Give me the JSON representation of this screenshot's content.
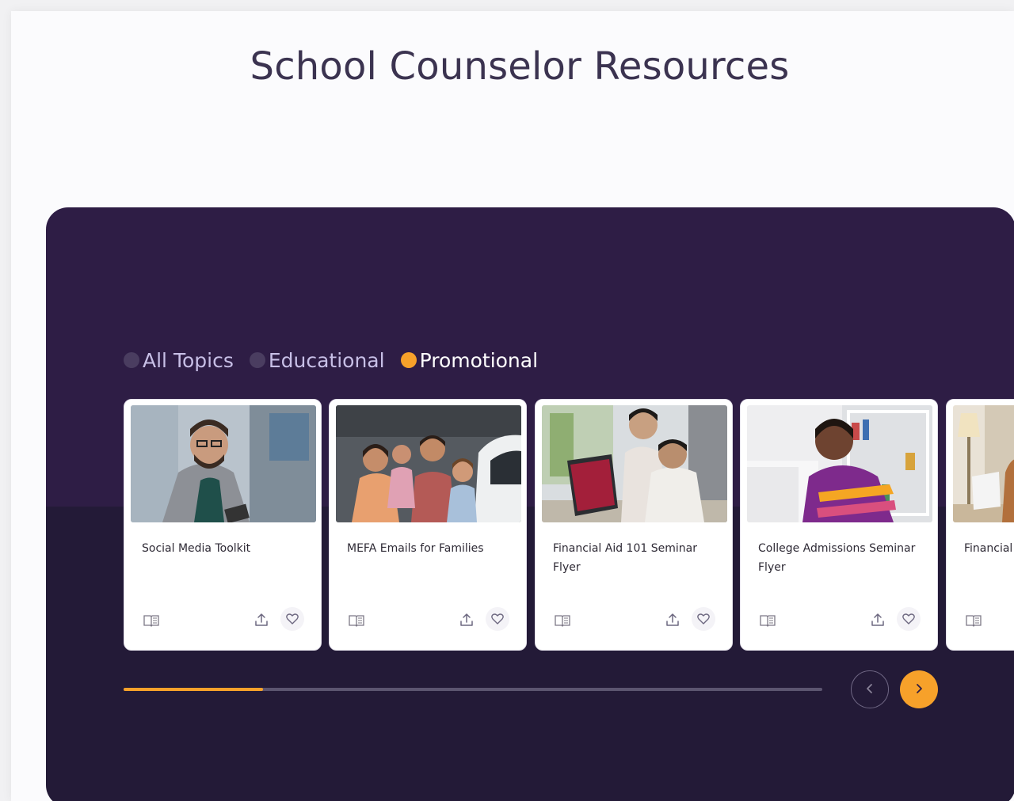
{
  "page": {
    "title": "School Counselor Resources"
  },
  "filters": [
    {
      "label": "All Topics",
      "active": false
    },
    {
      "label": "Educational",
      "active": false
    },
    {
      "label": "Promotional",
      "active": true
    }
  ],
  "cards": [
    {
      "title": "Social Media Toolkit",
      "image": "man-with-phone-photo"
    },
    {
      "title": "MEFA Emails for Families",
      "image": "family-by-car-photo"
    },
    {
      "title": "Financial Aid 101 Seminar Flyer",
      "image": "two-men-at-computer-photo"
    },
    {
      "title": "College Admissions Seminar Flyer",
      "image": "student-at-laptop-photo"
    },
    {
      "title": "Financial Aid & College Bills",
      "image": "woman-at-desk-photo"
    }
  ],
  "card_icons": {
    "read": "open-book-icon",
    "share": "upload-icon",
    "favorite": "heart-icon"
  },
  "carousel": {
    "progress": 0.2
  },
  "colors": {
    "accent": "#f7a12a",
    "panel": "#2e1d45",
    "title": "#3b3350"
  },
  "nav": {
    "prev": "chevron-left-icon",
    "next": "chevron-right-icon"
  }
}
